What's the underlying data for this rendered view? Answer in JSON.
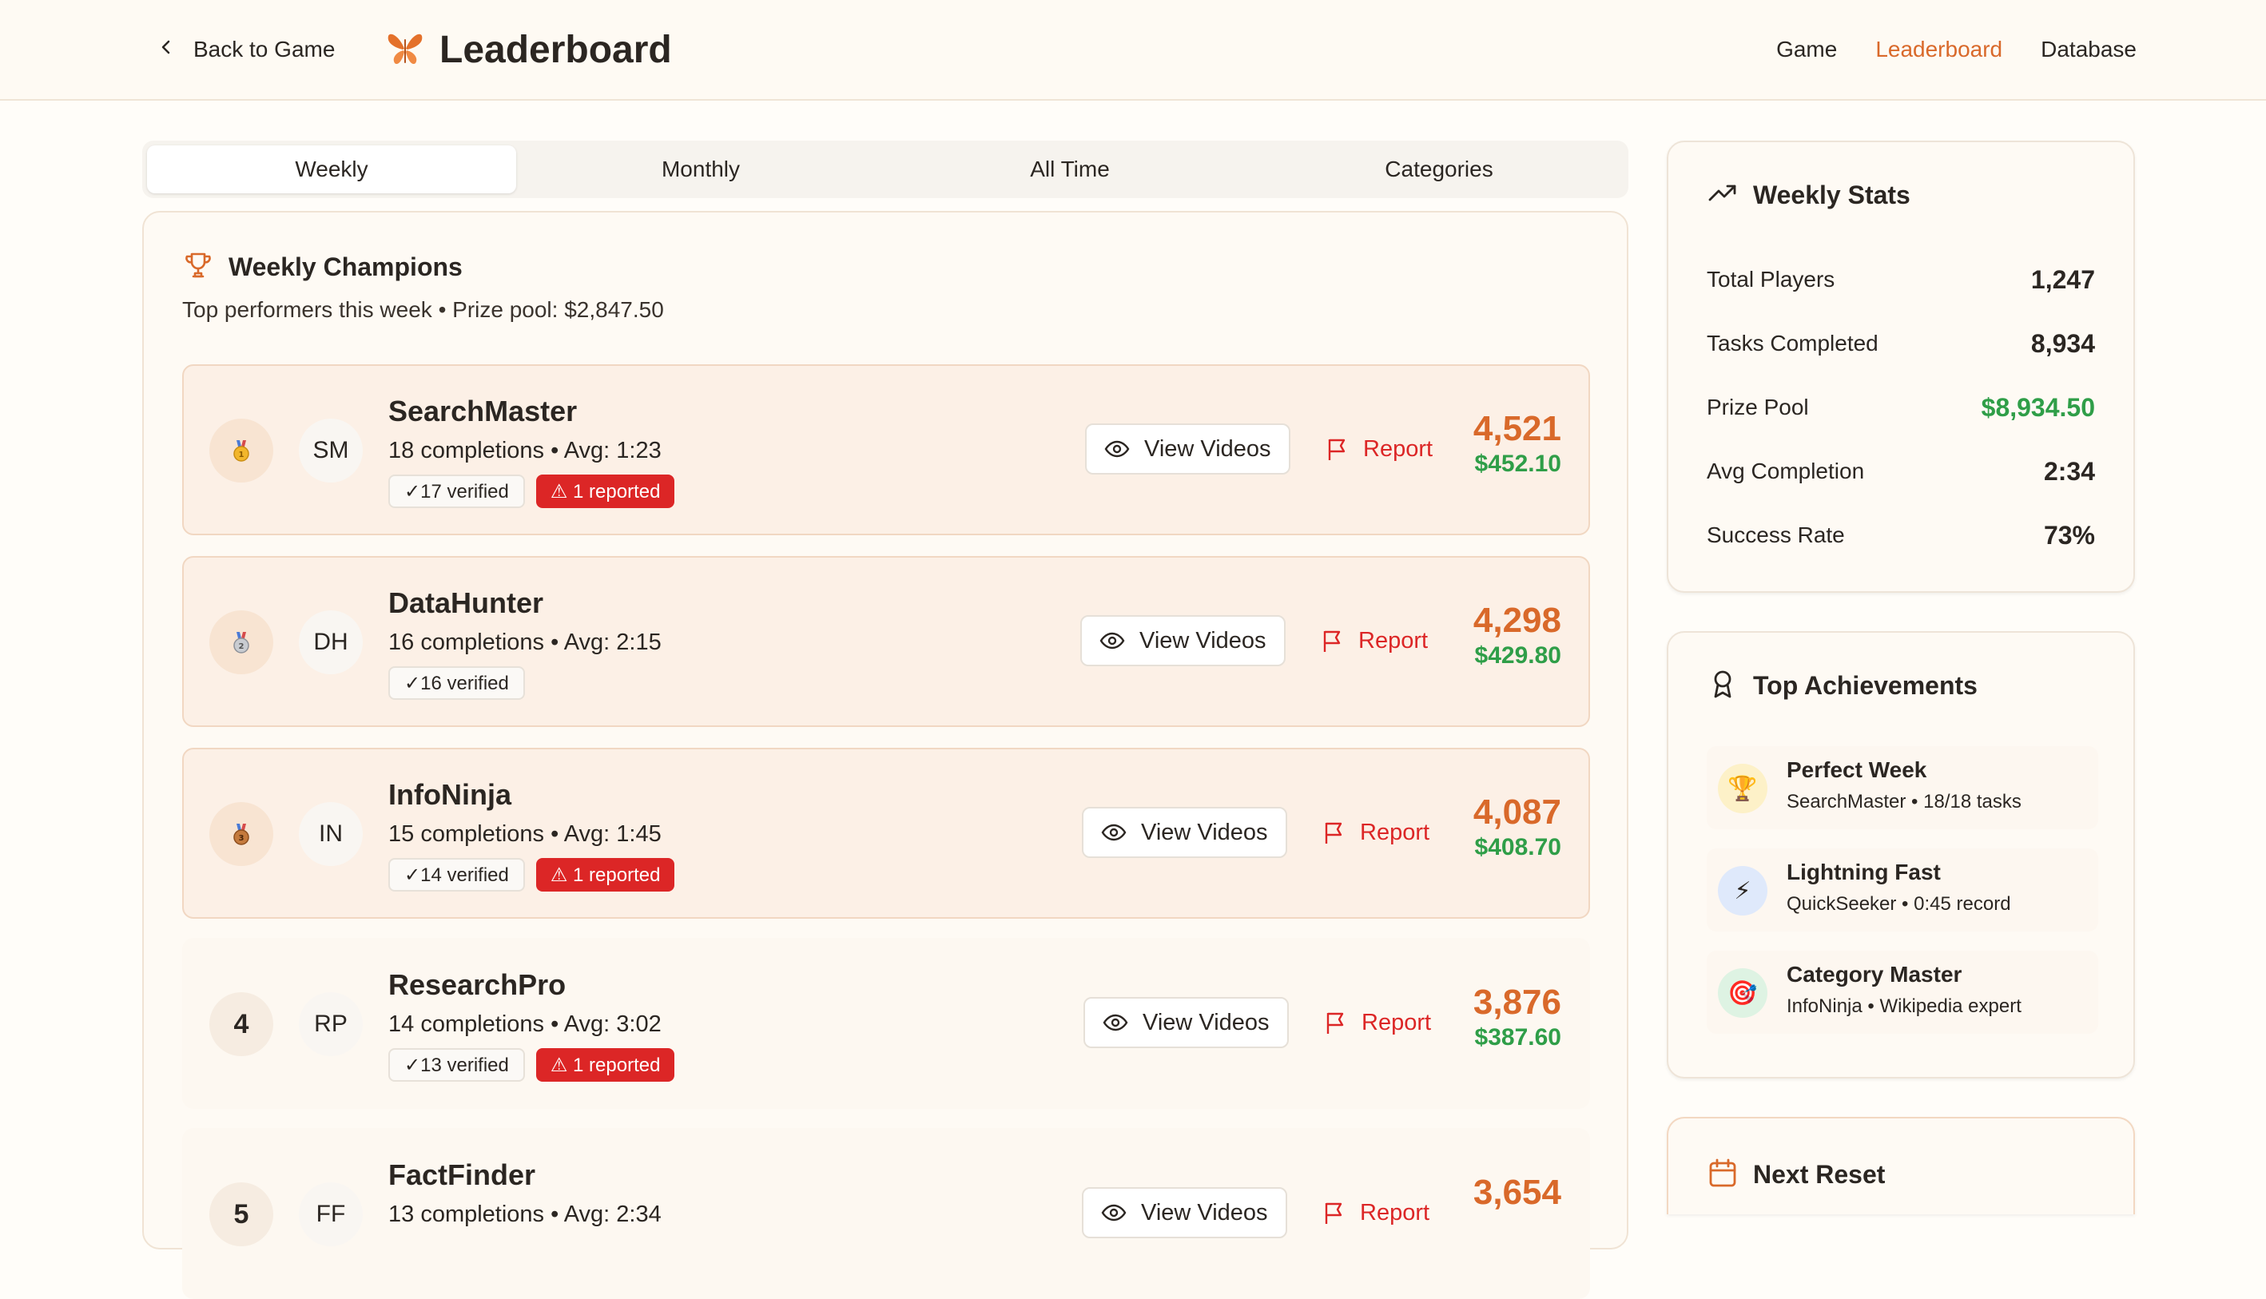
{
  "header": {
    "back_label": "Back to Game",
    "title": "Leaderboard",
    "nav": [
      "Game",
      "Leaderboard",
      "Database"
    ],
    "active_nav": "Leaderboard"
  },
  "tabs": [
    "Weekly",
    "Monthly",
    "All Time",
    "Categories"
  ],
  "active_tab": "Weekly",
  "champions": {
    "title": "Weekly Champions",
    "subtitle": "Top performers this week • Prize pool: $2,847.50",
    "view_videos_label": "View Videos",
    "report_label": "Report",
    "entries": [
      {
        "rank": "1",
        "medal": "gold",
        "initials": "SM",
        "name": "SearchMaster",
        "meta": "18 completions • Avg: 1:23",
        "verified": "✓17 verified",
        "reported": "⚠ 1 reported",
        "points": "4,521",
        "prize": "$452.10"
      },
      {
        "rank": "2",
        "medal": "silver",
        "initials": "DH",
        "name": "DataHunter",
        "meta": "16 completions • Avg: 2:15",
        "verified": "✓16 verified",
        "reported": "",
        "points": "4,298",
        "prize": "$429.80"
      },
      {
        "rank": "3",
        "medal": "bronze",
        "initials": "IN",
        "name": "InfoNinja",
        "meta": "15 completions • Avg: 1:45",
        "verified": "✓14 verified",
        "reported": "⚠ 1 reported",
        "points": "4,087",
        "prize": "$408.70"
      },
      {
        "rank": "4",
        "medal": "",
        "initials": "RP",
        "name": "ResearchPro",
        "meta": "14 completions • Avg: 3:02",
        "verified": "✓13 verified",
        "reported": "⚠ 1 reported",
        "points": "3,876",
        "prize": "$387.60"
      },
      {
        "rank": "5",
        "medal": "",
        "initials": "FF",
        "name": "FactFinder",
        "meta": "13 completions • Avg: 2:34",
        "verified": "",
        "reported": "",
        "points": "3,654",
        "prize": ""
      }
    ]
  },
  "weekly_stats": {
    "title": "Weekly Stats",
    "rows": [
      {
        "label": "Total Players",
        "value": "1,247"
      },
      {
        "label": "Tasks Completed",
        "value": "8,934"
      },
      {
        "label": "Prize Pool",
        "value": "$8,934.50"
      },
      {
        "label": "Avg Completion",
        "value": "2:34"
      },
      {
        "label": "Success Rate",
        "value": "73%"
      }
    ]
  },
  "achievements": {
    "title": "Top Achievements",
    "items": [
      {
        "icon": "trophy-icon",
        "glyph": "🏆",
        "title": "Perfect Week",
        "sub": "SearchMaster • 18/18 tasks"
      },
      {
        "icon": "lightning-icon",
        "glyph": "⚡",
        "title": "Lightning Fast",
        "sub": "QuickSeeker • 0:45 record"
      },
      {
        "icon": "target-icon",
        "glyph": "🎯",
        "title": "Category Master",
        "sub": "InfoNinja • Wikipedia expert"
      }
    ]
  },
  "next_reset": {
    "title": "Next Reset"
  },
  "colors": {
    "accent": "#d9692a",
    "prize_green": "#2f9e48",
    "report_red": "#dc2626"
  }
}
